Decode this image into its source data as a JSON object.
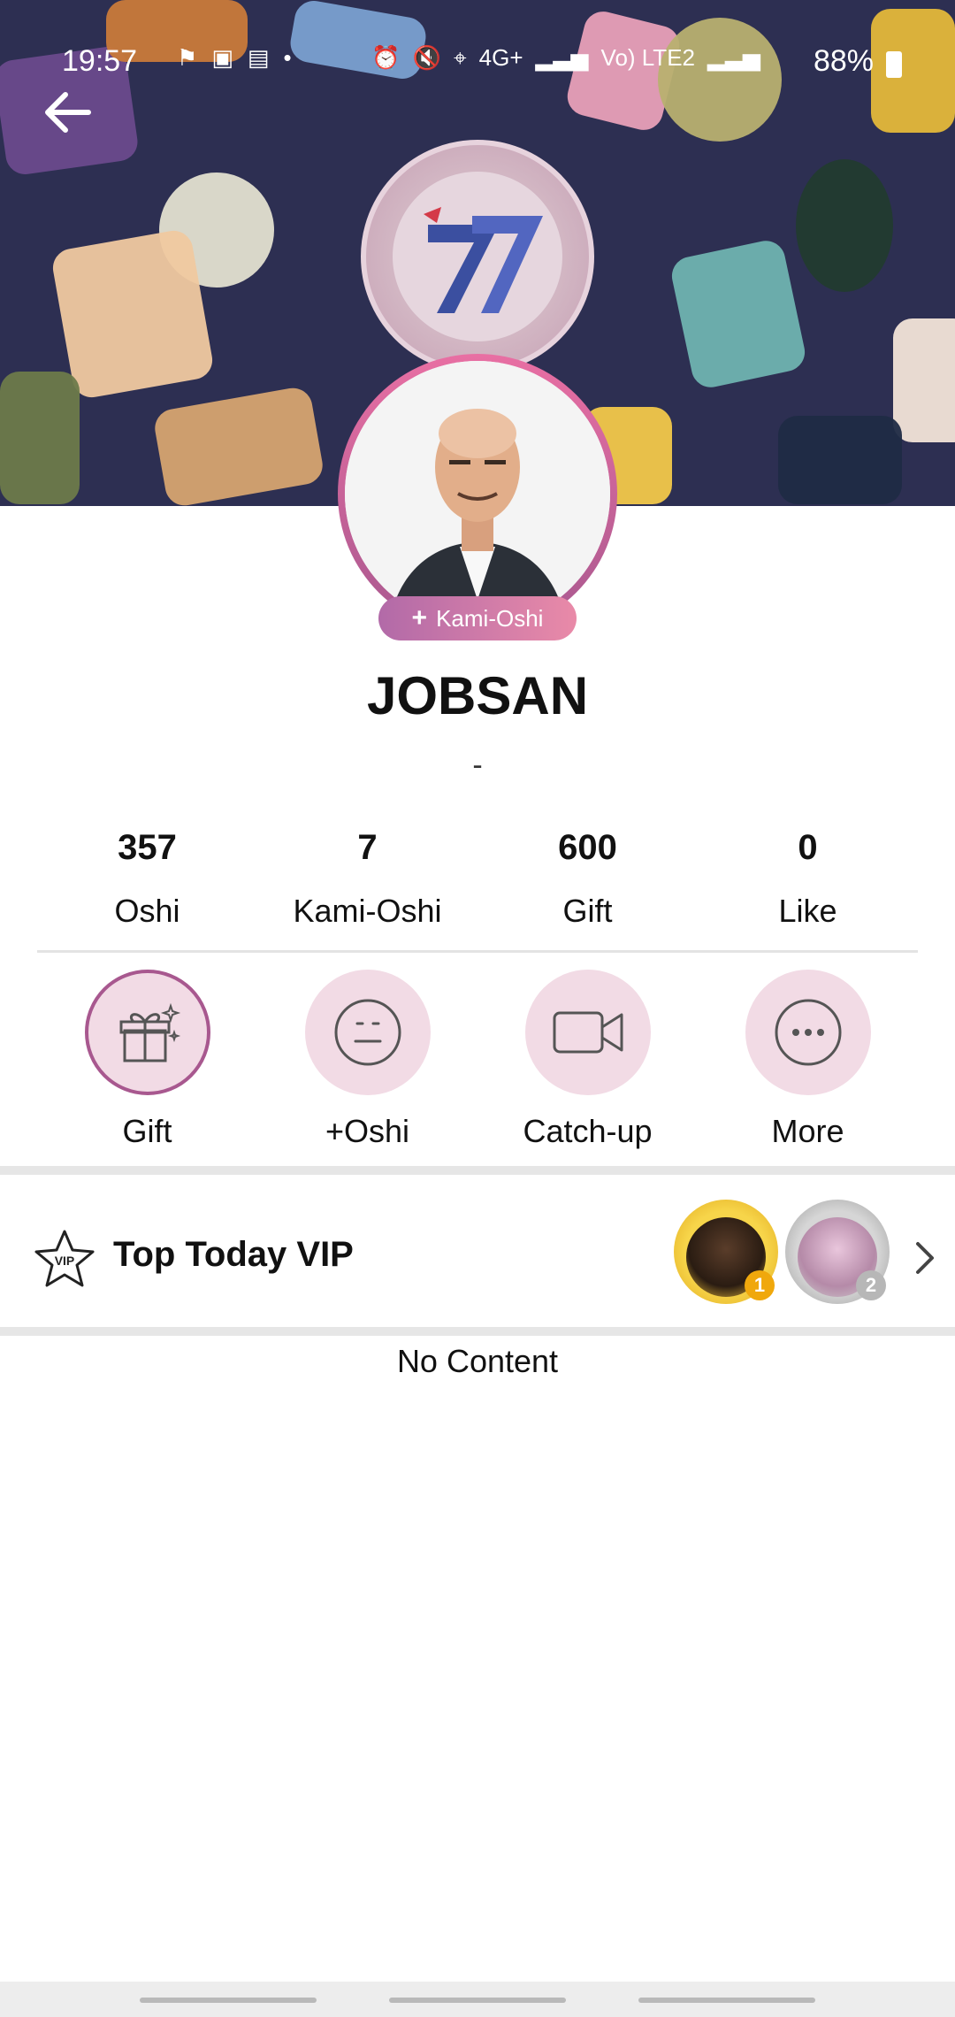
{
  "status_bar": {
    "time": "19:57",
    "battery": "88%",
    "network_left": "4G+",
    "network_right": "Vo) LTE2"
  },
  "header": {
    "back_icon": "arrow-left-icon"
  },
  "profile": {
    "badge_label": "Kami-Oshi",
    "name": "JOBSAN",
    "bio": "-"
  },
  "stats": [
    {
      "value": "357",
      "label": "Oshi"
    },
    {
      "value": "7",
      "label": "Kami-Oshi"
    },
    {
      "value": "600",
      "label": "Gift"
    },
    {
      "value": "0",
      "label": "Like"
    }
  ],
  "actions": [
    {
      "label": "Gift",
      "icon": "gift-icon"
    },
    {
      "label": "+Oshi",
      "icon": "neutral-face-icon"
    },
    {
      "label": "Catch-up",
      "icon": "video-camera-icon"
    },
    {
      "label": "More",
      "icon": "more-dots-icon"
    }
  ],
  "vip": {
    "title": "Top Today VIP",
    "star_text": "VIP",
    "ranks": [
      "1",
      "2"
    ]
  },
  "feed": {
    "empty_text": "No Content"
  },
  "colors": {
    "accent": "#a8588f",
    "accent_light": "#f2dbe5",
    "cover_bg": "#2d2f52"
  }
}
